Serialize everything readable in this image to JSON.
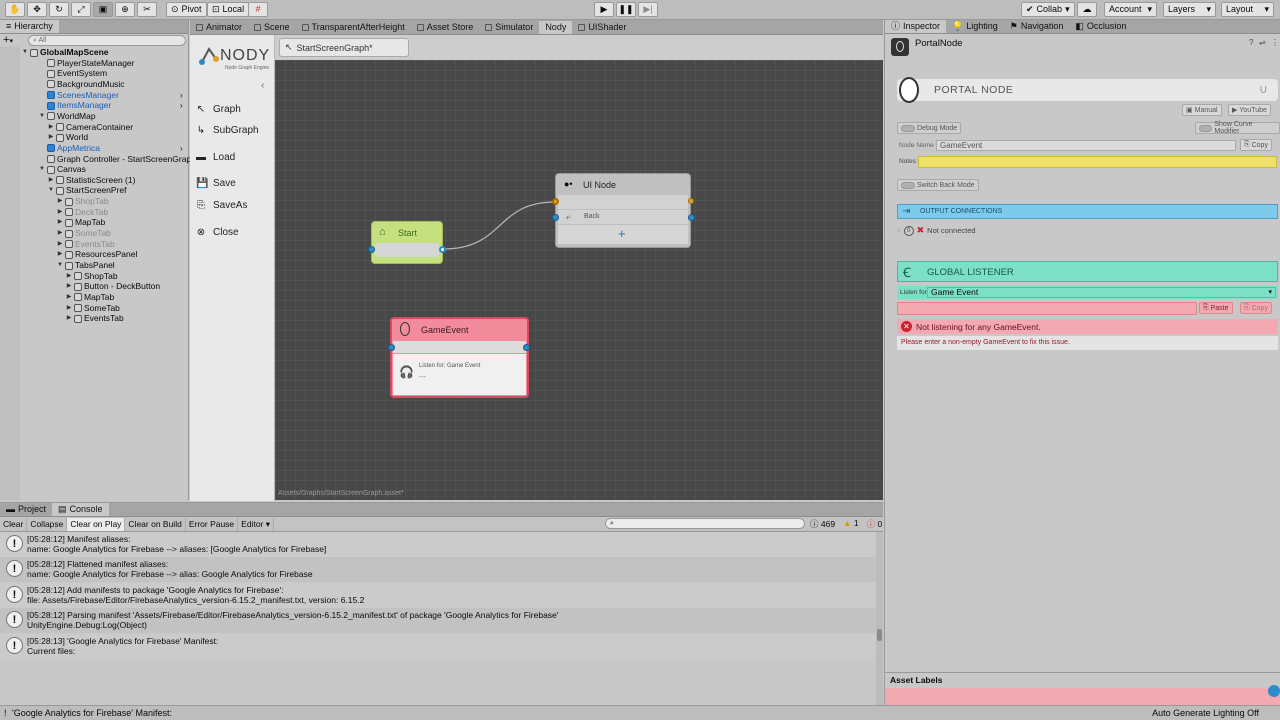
{
  "toolbar": {
    "pivot": "Pivot",
    "local": "Local",
    "collab": "Collab",
    "account": "Account",
    "layers": "Layers",
    "layout": "Layout"
  },
  "hierarchy": {
    "tab": "Hierarchy",
    "search_placeholder": "All",
    "items": [
      {
        "label": "GlobalMapScene",
        "indent": 0,
        "arrow": "▼",
        "bold": true,
        "icon": "scene"
      },
      {
        "label": "PlayerStateManager",
        "indent": 1,
        "arrow": "",
        "style": ""
      },
      {
        "label": "EventSystem",
        "indent": 1,
        "arrow": "",
        "style": ""
      },
      {
        "label": "BackgroundMusic",
        "indent": 1,
        "arrow": "",
        "style": ""
      },
      {
        "label": "ScenesManager",
        "indent": 1,
        "arrow": "",
        "style": "blue",
        "chev": true
      },
      {
        "label": "ItemsManager",
        "indent": 1,
        "arrow": "",
        "style": "blue",
        "chev": true
      },
      {
        "label": "WorldMap",
        "indent": 1,
        "arrow": "▼",
        "style": ""
      },
      {
        "label": "CameraContainer",
        "indent": 2,
        "arrow": "▶",
        "style": ""
      },
      {
        "label": "World",
        "indent": 2,
        "arrow": "▶",
        "style": ""
      },
      {
        "label": "AppMetrica",
        "indent": 1,
        "arrow": "",
        "style": "blue",
        "chev": true
      },
      {
        "label": "Graph Controller - StartScreenGraph",
        "indent": 1,
        "arrow": "",
        "style": ""
      },
      {
        "label": "Canvas",
        "indent": 1,
        "arrow": "▼",
        "style": ""
      },
      {
        "label": "StatisticScreen (1)",
        "indent": 2,
        "arrow": "▶",
        "style": ""
      },
      {
        "label": "StartScreenPref",
        "indent": 2,
        "arrow": "▼",
        "style": ""
      },
      {
        "label": "ShopTab",
        "indent": 3,
        "arrow": "▶",
        "style": "gray"
      },
      {
        "label": "DeckTab",
        "indent": 3,
        "arrow": "▶",
        "style": "gray"
      },
      {
        "label": "MapTab",
        "indent": 3,
        "arrow": "▶",
        "style": ""
      },
      {
        "label": "SomeTab",
        "indent": 3,
        "arrow": "▶",
        "style": "gray"
      },
      {
        "label": "EventsTab",
        "indent": 3,
        "arrow": "▶",
        "style": "gray"
      },
      {
        "label": "ResourcesPanel",
        "indent": 3,
        "arrow": "▶",
        "style": ""
      },
      {
        "label": "TabsPanel",
        "indent": 3,
        "arrow": "▼",
        "style": ""
      },
      {
        "label": "ShopTab",
        "indent": 4,
        "arrow": "▶",
        "style": ""
      },
      {
        "label": "Button - DeckButton",
        "indent": 4,
        "arrow": "▶",
        "style": ""
      },
      {
        "label": "MapTab",
        "indent": 4,
        "arrow": "▶",
        "style": ""
      },
      {
        "label": "SomeTab",
        "indent": 4,
        "arrow": "▶",
        "style": ""
      },
      {
        "label": "EventsTab",
        "indent": 4,
        "arrow": "▶",
        "style": ""
      }
    ]
  },
  "center_tabs": [
    "Animator",
    "Scene",
    "TransparentAfterHeight",
    "Asset Store",
    "Simulator",
    "Nody",
    "UIShader"
  ],
  "nody": {
    "logo": "NODY",
    "logo_sub": "Node Graph Engine",
    "menu": [
      "Graph",
      "SubGraph",
      "Load",
      "Save",
      "SaveAs",
      "Close"
    ],
    "breadcrumb": "StartScreenGraph*",
    "asset_path": "Assets/Graphs/StartScreenGraph.asset*"
  },
  "nodes": {
    "start": {
      "title": "Start"
    },
    "ui": {
      "title": "UI Node",
      "back": "Back",
      "add": "+"
    },
    "gameevent": {
      "title": "GameEvent",
      "listen": "Listen for: Game Event",
      "value": "---"
    }
  },
  "console": {
    "tabs": [
      "Project",
      "Console"
    ],
    "buttons": [
      "Clear",
      "Collapse",
      "Clear on Play",
      "Clear on Build",
      "Error Pause",
      "Editor ▾"
    ],
    "count_log": "469",
    "count_warn": "1",
    "count_err": "0",
    "logs": [
      {
        "line1": "[05:28:12] Manifest aliases:",
        "line2": "name: Google Analytics for Firebase --> aliases: [Google Analytics for Firebase]"
      },
      {
        "line1": "[05:28:12] Flattened manifest aliases:",
        "line2": "name: Google Analytics for Firebase --> alias: Google Analytics for Firebase"
      },
      {
        "line1": "[05:28:12] Add manifests to package 'Google Analytics for Firebase':",
        "line2": "file: Assets/Firebase/Editor/FirebaseAnalytics_version-6.15.2_manifest.txt, version: 6.15.2"
      },
      {
        "line1": "[05:28:12] Parsing manifest 'Assets/Firebase/Editor/FirebaseAnalytics_version-6.15.2_manifest.txt' of package 'Google Analytics for Firebase'",
        "line2": "UnityEngine.Debug:Log(Object)"
      },
      {
        "line1": "[05:28:13] 'Google Analytics for Firebase' Manifest:",
        "line2": "Current files:"
      }
    ]
  },
  "inspector": {
    "tabs": [
      "Inspector",
      "Lighting",
      "Navigation",
      "Occlusion"
    ],
    "object_name": "PortalNode",
    "header_title": "PORTAL NODE",
    "manual": "Manual",
    "youtube": "YouTube",
    "debug_mode": "Debug Mode",
    "show_curve": "Show Curve Modifier",
    "node_name_label": "Node Name",
    "node_name_value": "GameEvent",
    "copy": "Copy",
    "notes_label": "Notes",
    "switch_back": "Switch Back Mode",
    "output_connections": "OUTPUT CONNECTIONS",
    "connection_index": "0",
    "not_connected": "Not connected",
    "global_listener": "GLOBAL LISTENER",
    "listen_for_label": "Listen for",
    "listen_for_value": "Game Event",
    "paste": "Paste",
    "error_title": "Not listening for any GameEvent.",
    "error_hint": "Please enter a non-empty GameEvent to fix this issue.",
    "asset_labels": "Asset Labels"
  },
  "status": {
    "left": "'Google Analytics for Firebase' Manifest:",
    "right": "Auto Generate Lighting Off"
  },
  "colors": {
    "start_node": "#c5e07e",
    "gameevent_node": "#f28b9c",
    "output_bar": "#7ccbea",
    "global_listener": "#7ddfc5",
    "notes": "#efe06a",
    "error": "#f2a9b1"
  }
}
